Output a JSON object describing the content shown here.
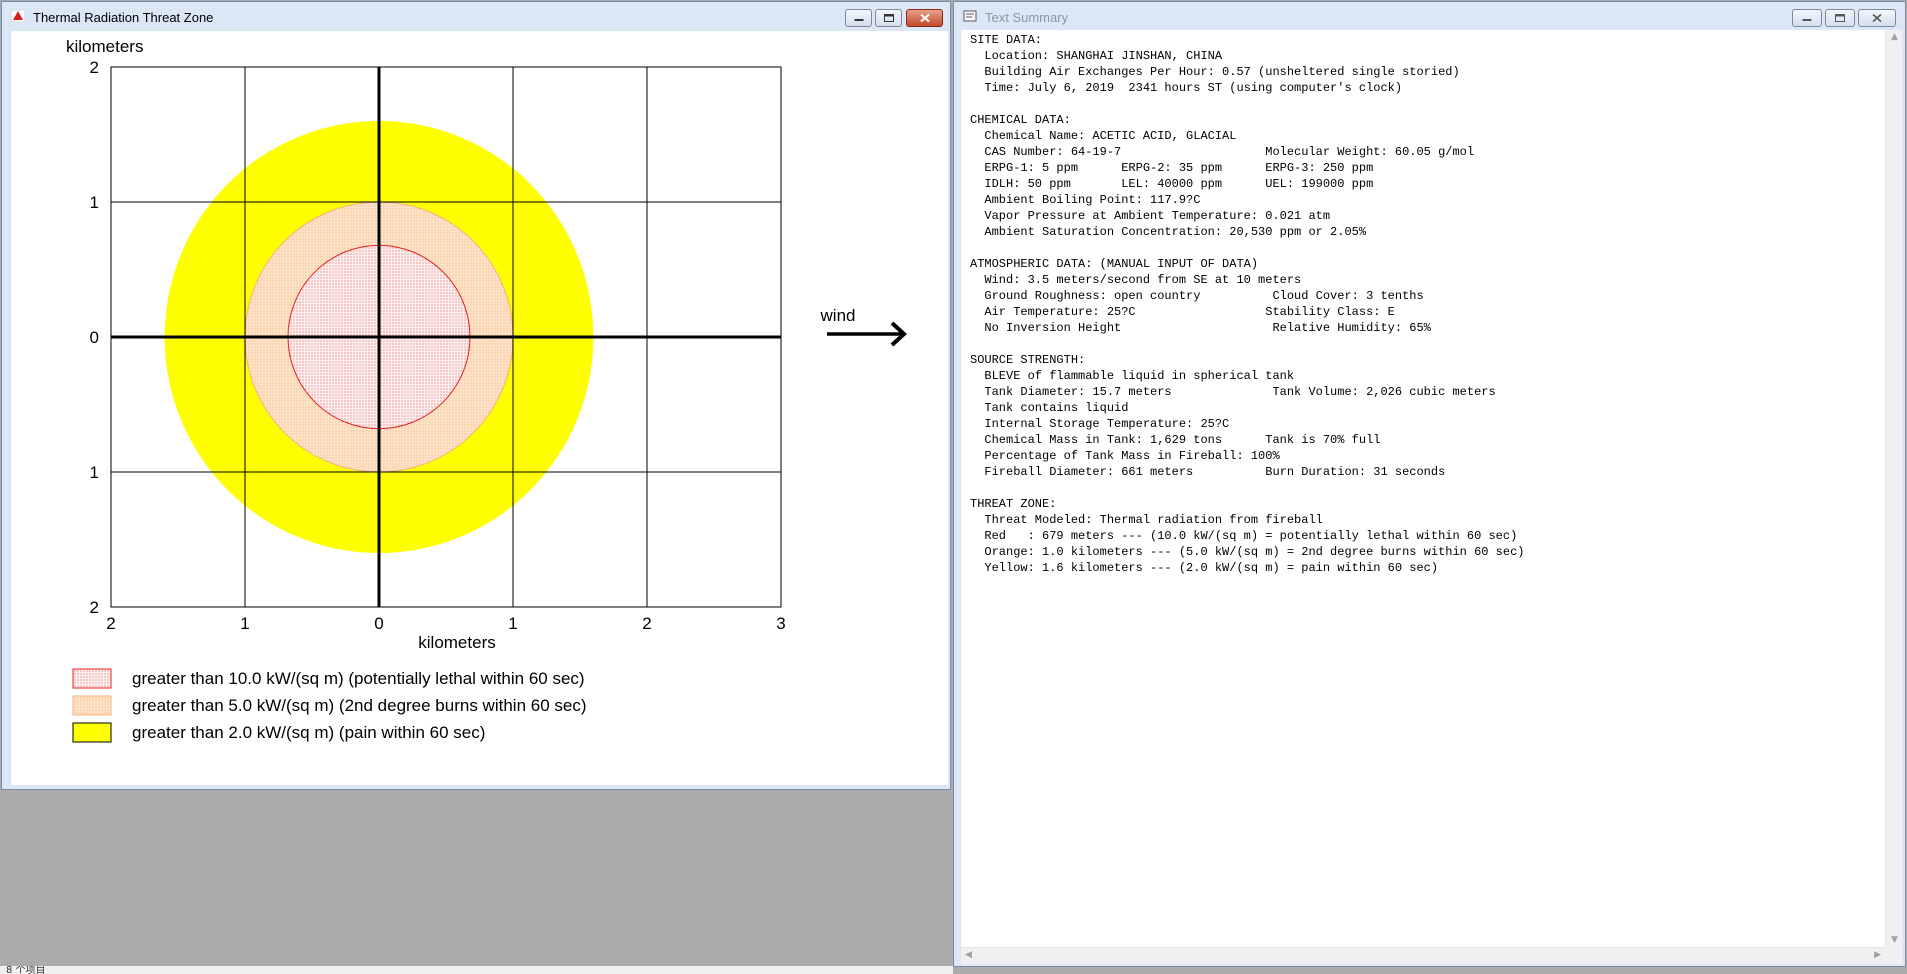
{
  "thermal_window": {
    "title": "Thermal Radiation Threat Zone",
    "y_axis_label": "kilometers",
    "x_axis_label": "kilometers",
    "wind_label": "wind",
    "y_ticks": [
      "2",
      "1",
      "0",
      "1",
      "2"
    ],
    "x_ticks": [
      "2",
      "1",
      "0",
      "1",
      "2",
      "3"
    ],
    "legend": [
      {
        "label": "greater than 10.0 kW/(sq m) (potentially lethal within 60 sec)",
        "color": "#ff0000"
      },
      {
        "label": "greater than 5.0 kW/(sq m) (2nd degree burns within 60 sec)",
        "color": "#ffa64d"
      },
      {
        "label": "greater than 2.0 kW/(sq m) (pain within 60 sec)",
        "color": "#ffff00"
      }
    ]
  },
  "chart_data": {
    "type": "diagram",
    "xlabel": "kilometers",
    "ylabel": "kilometers",
    "xlim": [
      -2,
      3
    ],
    "ylim": [
      -2,
      2
    ],
    "grid": true,
    "zones": [
      {
        "name": "Yellow",
        "radius_km": 1.6,
        "color": "#ffff00"
      },
      {
        "name": "Orange",
        "radius_km": 1.0,
        "color": "#fde3c8"
      },
      {
        "name": "Red",
        "radius_km": 0.679,
        "color": "#fff0f0"
      }
    ]
  },
  "summary_window": {
    "title": "Text Summary",
    "lines": [
      "SITE DATA:",
      "  Location: SHANGHAI JINSHAN, CHINA",
      "  Building Air Exchanges Per Hour: 0.57 (unsheltered single storied)",
      "  Time: July 6, 2019  2341 hours ST (using computer's clock)",
      "",
      "CHEMICAL DATA:",
      "  Chemical Name: ACETIC ACID, GLACIAL",
      "  CAS Number: 64-19-7                    Molecular Weight: 60.05 g/mol",
      "  ERPG-1: 5 ppm      ERPG-2: 35 ppm      ERPG-3: 250 ppm",
      "  IDLH: 50 ppm       LEL: 40000 ppm      UEL: 199000 ppm",
      "  Ambient Boiling Point: 117.9?C",
      "  Vapor Pressure at Ambient Temperature: 0.021 atm",
      "  Ambient Saturation Concentration: 20,530 ppm or 2.05%",
      "",
      "ATMOSPHERIC DATA: (MANUAL INPUT OF DATA)",
      "  Wind: 3.5 meters/second from SE at 10 meters",
      "  Ground Roughness: open country          Cloud Cover: 3 tenths",
      "  Air Temperature: 25?C                  Stability Class: E",
      "  No Inversion Height                     Relative Humidity: 65%",
      "",
      "SOURCE STRENGTH:",
      "  BLEVE of flammable liquid in spherical tank",
      "  Tank Diameter: 15.7 meters              Tank Volume: 2,026 cubic meters",
      "  Tank contains liquid",
      "  Internal Storage Temperature: 25?C",
      "  Chemical Mass in Tank: 1,629 tons      Tank is 70% full",
      "  Percentage of Tank Mass in Fireball: 100%",
      "  Fireball Diameter: 661 meters          Burn Duration: 31 seconds",
      "",
      "THREAT ZONE:",
      "  Threat Modeled: Thermal radiation from fireball",
      "  Red   : 679 meters --- (10.0 kW/(sq m) = potentially lethal within 60 sec)",
      "  Orange: 1.0 kilometers --- (5.0 kW/(sq m) = 2nd degree burns within 60 sec)",
      "  Yellow: 1.6 kilometers --- (2.0 kW/(sq m) = pain within 60 sec)"
    ]
  },
  "status_bar": {
    "text": "8 个项目"
  }
}
